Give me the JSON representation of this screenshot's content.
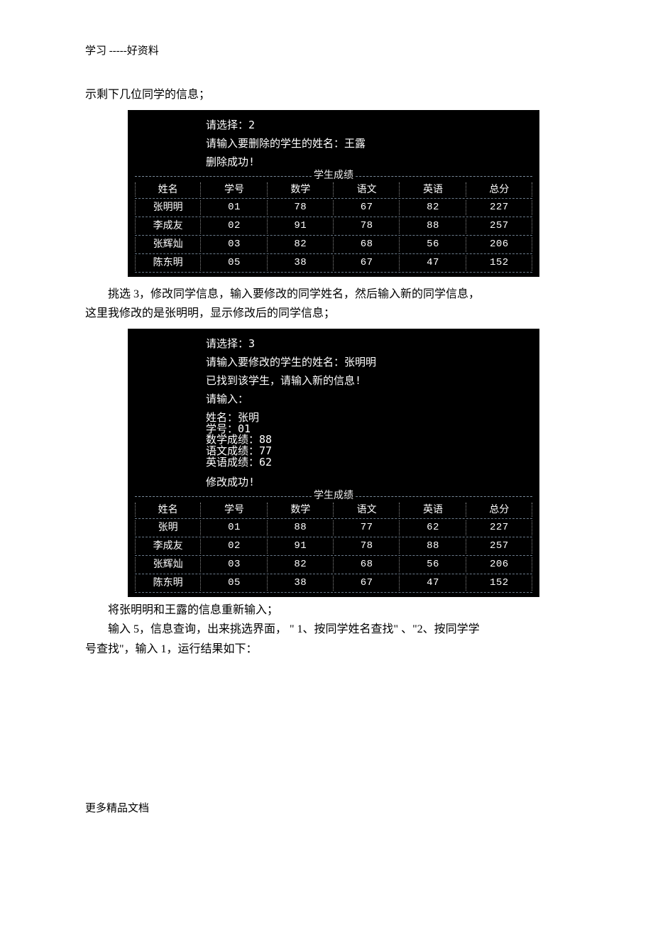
{
  "header": "学习  -----好资料",
  "intro1": "示剩下几位同学的信息；",
  "terminal1": {
    "prompt_select": "请选择：2",
    "prompt_input": "请输入要删除的学生的姓名：王露",
    "result": "删除成功!",
    "table_title": "学生成绩",
    "headers": [
      "姓名",
      "学号",
      "数学",
      "语文",
      "英语",
      "总分"
    ],
    "rows": [
      [
        "张明明",
        "01",
        "78",
        "67",
        "82",
        "227"
      ],
      [
        "李成友",
        "02",
        "91",
        "78",
        "88",
        "257"
      ],
      [
        "张辉灿",
        "03",
        "82",
        "68",
        "56",
        "206"
      ],
      [
        "陈东明",
        "05",
        "38",
        "67",
        "47",
        "152"
      ]
    ]
  },
  "para2a": "挑选 3，修改同学信息，输入要修改的同学姓名，然后输入新的同学信息，",
  "para2b": "这里我修改的是张明明，显示修改后的同学信息；",
  "terminal2": {
    "prompt_select": "请选择：3",
    "prompt_input": "请输入要修改的学生的姓名：张明明",
    "found": "已找到该学生，请输入新的信息!",
    "please_input": "请输入：",
    "fields": [
      "姓名：张明",
      "学号：01",
      "数学成绩：88",
      "语文成绩：77",
      "英语成绩：62"
    ],
    "result": "修改成功!",
    "table_title": "学生成绩",
    "headers": [
      "姓名",
      "学号",
      "数学",
      "语文",
      "英语",
      "总分"
    ],
    "rows": [
      [
        "张明",
        "01",
        "88",
        "77",
        "62",
        "227"
      ],
      [
        "李成友",
        "02",
        "91",
        "78",
        "88",
        "257"
      ],
      [
        "张辉灿",
        "03",
        "82",
        "68",
        "56",
        "206"
      ],
      [
        "陈东明",
        "05",
        "38",
        "67",
        "47",
        "152"
      ]
    ]
  },
  "para3a": "将张明明和王露的信息重新输入；",
  "para3b": "输入 5，信息查询，出来挑选界面， \" 1、按同学姓名查找\" 、\"2、按同学学",
  "para3c": "号查找\"，输入 1，运行结果如下：",
  "footer": "更多精品文档"
}
